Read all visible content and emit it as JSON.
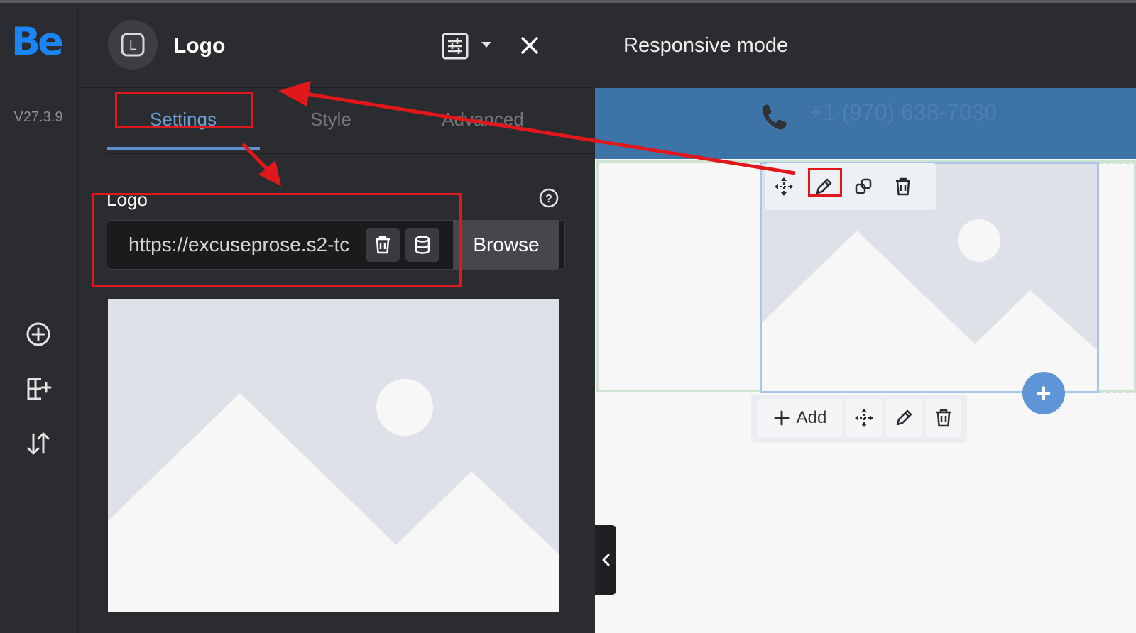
{
  "app": {
    "brand": "Be",
    "version": "V27.3.9"
  },
  "rail": {
    "items": [
      {
        "icon": "plus-circle-icon"
      },
      {
        "icon": "add-section-icon"
      },
      {
        "icon": "sort-arrows-icon"
      }
    ]
  },
  "panel": {
    "element_letter": "L",
    "title": "Logo",
    "tabs": [
      {
        "label": "Settings",
        "active": true
      },
      {
        "label": "Style",
        "active": false
      },
      {
        "label": "Advanced",
        "active": false
      }
    ],
    "field": {
      "label": "Logo",
      "value": "https://excuseprose.s2-tc",
      "browse_label": "Browse"
    }
  },
  "canvas": {
    "mode_label": "Responsive mode",
    "phone": "+1 (970) 638-7030",
    "add_label": "Add"
  },
  "colors": {
    "accent": "#1a85f5",
    "tab_active": "#6c9fd6",
    "header_bar": "#3d74a8",
    "annotation": "#e0181b",
    "fab": "#5d95d6"
  }
}
